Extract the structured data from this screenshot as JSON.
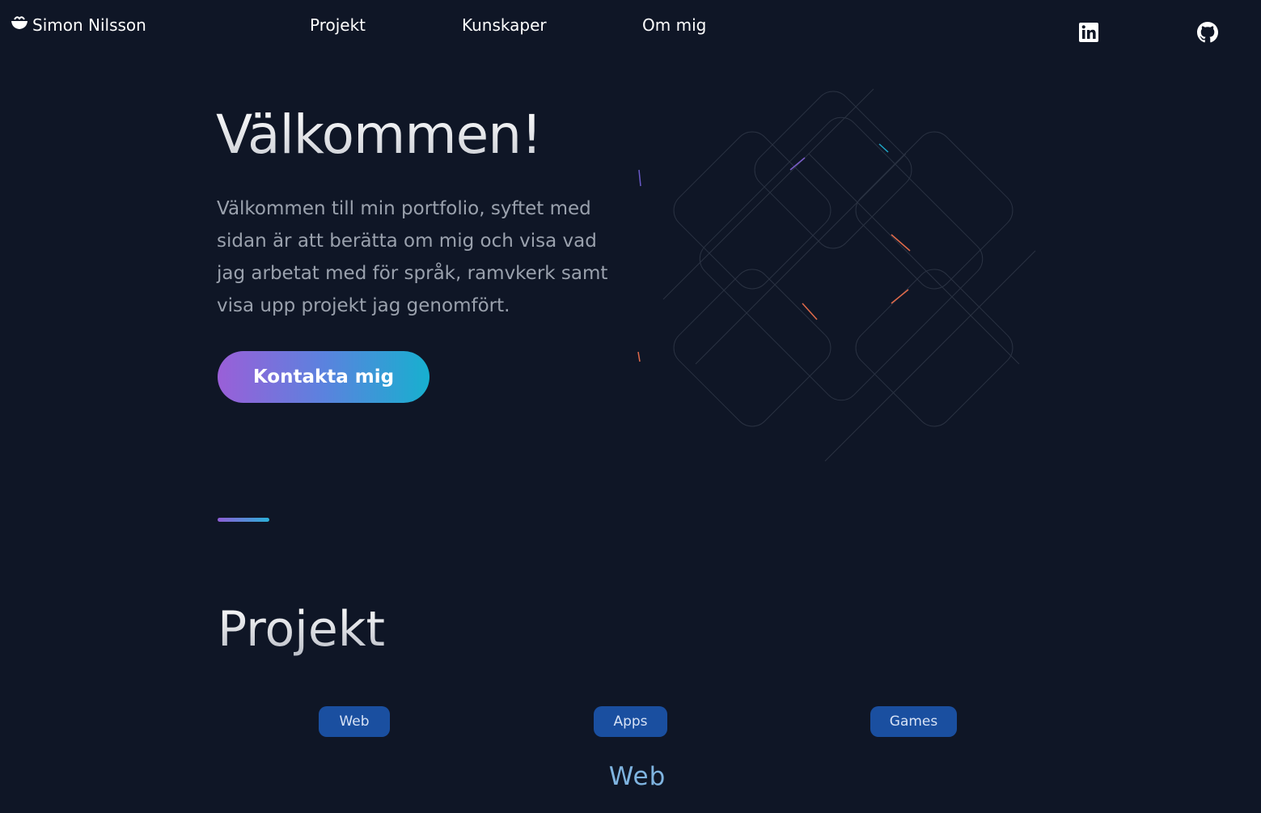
{
  "nav": {
    "brand_name": "Simon Nilsson",
    "brand_icon": "bowl-icon",
    "links": [
      "Projekt",
      "Kunskaper",
      "Om mig"
    ],
    "social": [
      "linkedin-icon",
      "github-icon"
    ]
  },
  "hero": {
    "title": "Välkommen!",
    "text": "Välkommen till min portfolio, syftet med sidan är att berätta om mig och visa vad jag arbetat med för språk, ramvkerk samt visa upp projekt jag genomfört.",
    "cta_label": "Kontakta mig"
  },
  "projects": {
    "title": "Projekt",
    "filters": [
      "Web",
      "Apps",
      "Games"
    ],
    "active_heading": "Web"
  },
  "colors": {
    "background": "#0f1626",
    "cta_gradient_start": "#9a5fd8",
    "cta_gradient_end": "#17b0cf",
    "filter_button": "#1a4fa0",
    "sub_heading": "#7fb4e0"
  }
}
